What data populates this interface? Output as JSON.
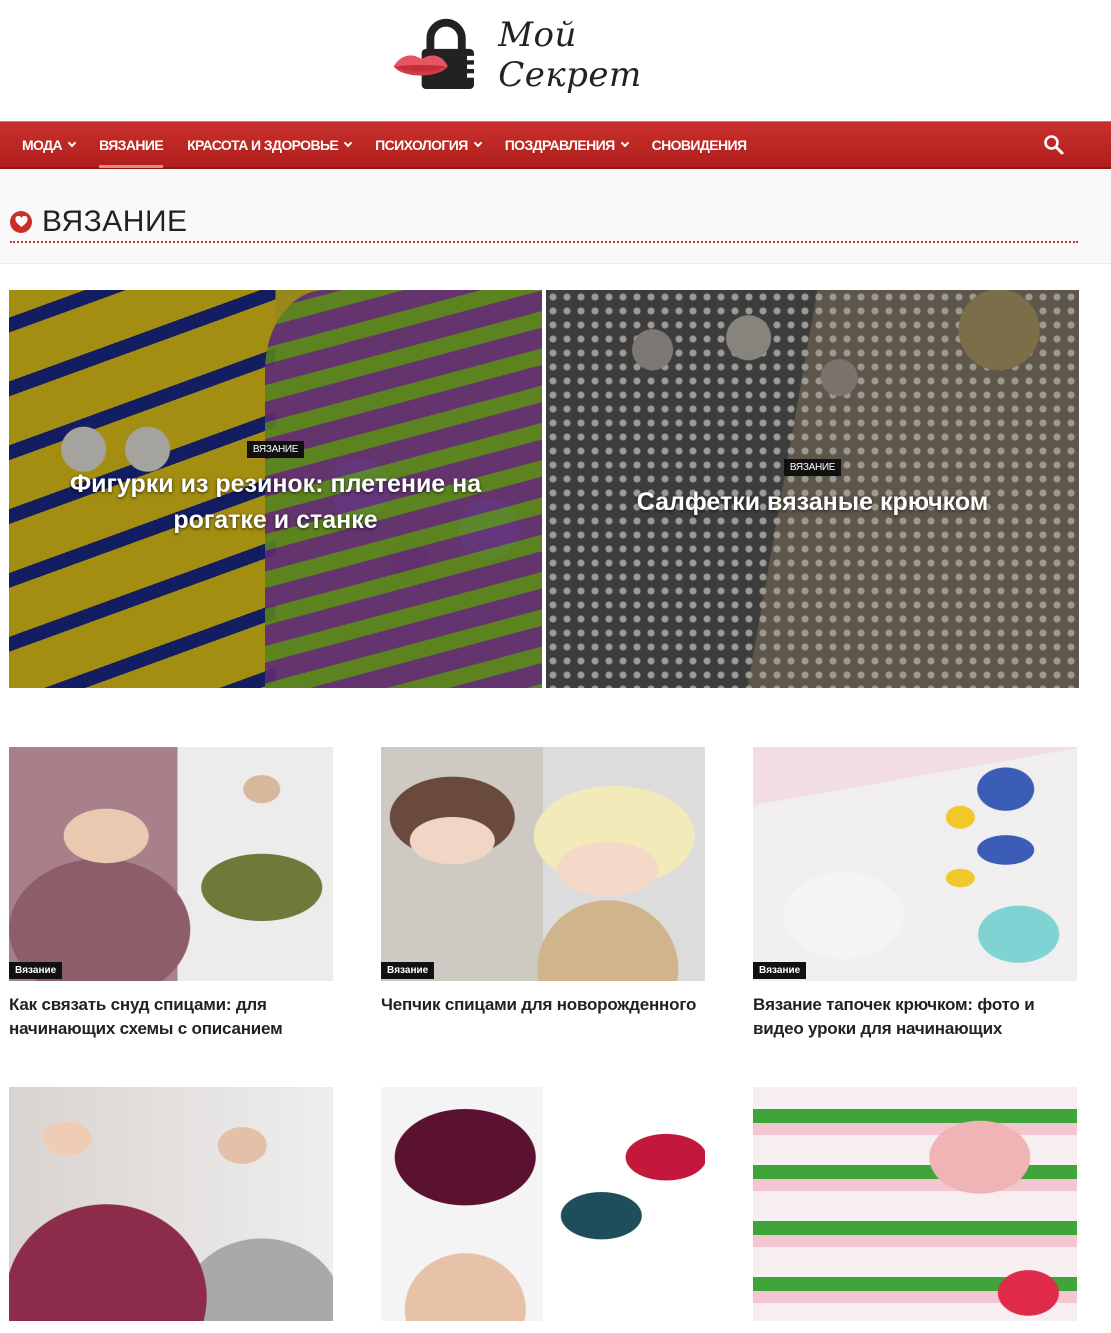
{
  "logo": {
    "text": "Мой Секрет"
  },
  "nav": {
    "items": [
      {
        "label": "МОДА",
        "dropdown": true
      },
      {
        "label": "ВЯЗАНИЕ",
        "dropdown": false,
        "active": true
      },
      {
        "label": "КРАСОТА И ЗДОРОВЬЕ",
        "dropdown": true
      },
      {
        "label": "ПСИХОЛОГИЯ",
        "dropdown": true
      },
      {
        "label": "ПОЗДРАВЛЕНИЯ",
        "dropdown": true
      },
      {
        "label": "СНОВИДЕНИЯ",
        "dropdown": false
      }
    ],
    "search_icon": "search-icon"
  },
  "section": {
    "title": "ВЯЗАНИЕ",
    "icon": "heart-icon"
  },
  "featured": [
    {
      "tag": "ВЯЗАНИЕ",
      "title": "Фигурки из резинок: плетение на рогатке и станке"
    },
    {
      "tag": "ВЯЗАНИЕ",
      "title": "Салфетки вязаные крючком"
    }
  ],
  "cards": [
    {
      "tag": "Вязание",
      "title": "Как связать снуд спицами: для начинающих схемы с описанием"
    },
    {
      "tag": "Вязание",
      "title": "Чепчик спицами для новорожденного"
    },
    {
      "tag": "Вязание",
      "title": "Вязание тапочек крючком: фото и видео уроки для начинающих"
    },
    {
      "tag": "",
      "title": ""
    },
    {
      "tag": "",
      "title": ""
    },
    {
      "tag": "",
      "title": ""
    }
  ],
  "colors": {
    "brand": "#c9302c",
    "nav_dark": "#b01f1c",
    "text": "#222222"
  }
}
